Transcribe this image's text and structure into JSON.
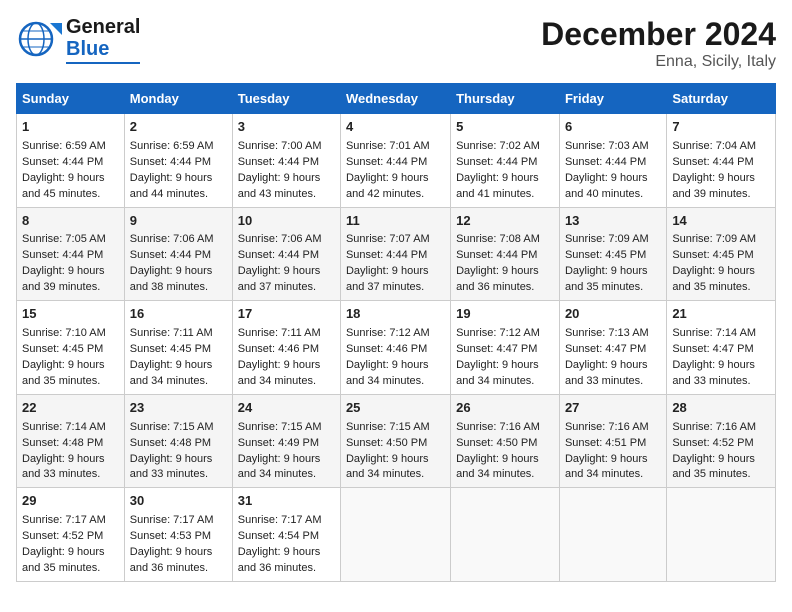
{
  "header": {
    "logo_line1": "General",
    "logo_line2": "Blue",
    "title": "December 2024",
    "subtitle": "Enna, Sicily, Italy"
  },
  "days_of_week": [
    "Sunday",
    "Monday",
    "Tuesday",
    "Wednesday",
    "Thursday",
    "Friday",
    "Saturday"
  ],
  "weeks": [
    [
      {
        "day": "1",
        "sunrise": "6:59 AM",
        "sunset": "4:44 PM",
        "daylight": "9 hours and 45 minutes."
      },
      {
        "day": "2",
        "sunrise": "6:59 AM",
        "sunset": "4:44 PM",
        "daylight": "9 hours and 44 minutes."
      },
      {
        "day": "3",
        "sunrise": "7:00 AM",
        "sunset": "4:44 PM",
        "daylight": "9 hours and 43 minutes."
      },
      {
        "day": "4",
        "sunrise": "7:01 AM",
        "sunset": "4:44 PM",
        "daylight": "9 hours and 42 minutes."
      },
      {
        "day": "5",
        "sunrise": "7:02 AM",
        "sunset": "4:44 PM",
        "daylight": "9 hours and 41 minutes."
      },
      {
        "day": "6",
        "sunrise": "7:03 AM",
        "sunset": "4:44 PM",
        "daylight": "9 hours and 40 minutes."
      },
      {
        "day": "7",
        "sunrise": "7:04 AM",
        "sunset": "4:44 PM",
        "daylight": "9 hours and 39 minutes."
      }
    ],
    [
      {
        "day": "8",
        "sunrise": "7:05 AM",
        "sunset": "4:44 PM",
        "daylight": "9 hours and 39 minutes."
      },
      {
        "day": "9",
        "sunrise": "7:06 AM",
        "sunset": "4:44 PM",
        "daylight": "9 hours and 38 minutes."
      },
      {
        "day": "10",
        "sunrise": "7:06 AM",
        "sunset": "4:44 PM",
        "daylight": "9 hours and 37 minutes."
      },
      {
        "day": "11",
        "sunrise": "7:07 AM",
        "sunset": "4:44 PM",
        "daylight": "9 hours and 37 minutes."
      },
      {
        "day": "12",
        "sunrise": "7:08 AM",
        "sunset": "4:44 PM",
        "daylight": "9 hours and 36 minutes."
      },
      {
        "day": "13",
        "sunrise": "7:09 AM",
        "sunset": "4:45 PM",
        "daylight": "9 hours and 35 minutes."
      },
      {
        "day": "14",
        "sunrise": "7:09 AM",
        "sunset": "4:45 PM",
        "daylight": "9 hours and 35 minutes."
      }
    ],
    [
      {
        "day": "15",
        "sunrise": "7:10 AM",
        "sunset": "4:45 PM",
        "daylight": "9 hours and 35 minutes."
      },
      {
        "day": "16",
        "sunrise": "7:11 AM",
        "sunset": "4:45 PM",
        "daylight": "9 hours and 34 minutes."
      },
      {
        "day": "17",
        "sunrise": "7:11 AM",
        "sunset": "4:46 PM",
        "daylight": "9 hours and 34 minutes."
      },
      {
        "day": "18",
        "sunrise": "7:12 AM",
        "sunset": "4:46 PM",
        "daylight": "9 hours and 34 minutes."
      },
      {
        "day": "19",
        "sunrise": "7:12 AM",
        "sunset": "4:47 PM",
        "daylight": "9 hours and 34 minutes."
      },
      {
        "day": "20",
        "sunrise": "7:13 AM",
        "sunset": "4:47 PM",
        "daylight": "9 hours and 33 minutes."
      },
      {
        "day": "21",
        "sunrise": "7:14 AM",
        "sunset": "4:47 PM",
        "daylight": "9 hours and 33 minutes."
      }
    ],
    [
      {
        "day": "22",
        "sunrise": "7:14 AM",
        "sunset": "4:48 PM",
        "daylight": "9 hours and 33 minutes."
      },
      {
        "day": "23",
        "sunrise": "7:15 AM",
        "sunset": "4:48 PM",
        "daylight": "9 hours and 33 minutes."
      },
      {
        "day": "24",
        "sunrise": "7:15 AM",
        "sunset": "4:49 PM",
        "daylight": "9 hours and 34 minutes."
      },
      {
        "day": "25",
        "sunrise": "7:15 AM",
        "sunset": "4:50 PM",
        "daylight": "9 hours and 34 minutes."
      },
      {
        "day": "26",
        "sunrise": "7:16 AM",
        "sunset": "4:50 PM",
        "daylight": "9 hours and 34 minutes."
      },
      {
        "day": "27",
        "sunrise": "7:16 AM",
        "sunset": "4:51 PM",
        "daylight": "9 hours and 34 minutes."
      },
      {
        "day": "28",
        "sunrise": "7:16 AM",
        "sunset": "4:52 PM",
        "daylight": "9 hours and 35 minutes."
      }
    ],
    [
      {
        "day": "29",
        "sunrise": "7:17 AM",
        "sunset": "4:52 PM",
        "daylight": "9 hours and 35 minutes."
      },
      {
        "day": "30",
        "sunrise": "7:17 AM",
        "sunset": "4:53 PM",
        "daylight": "9 hours and 36 minutes."
      },
      {
        "day": "31",
        "sunrise": "7:17 AM",
        "sunset": "4:54 PM",
        "daylight": "9 hours and 36 minutes."
      },
      null,
      null,
      null,
      null
    ]
  ],
  "labels": {
    "sunrise": "Sunrise:",
    "sunset": "Sunset:",
    "daylight": "Daylight:"
  }
}
